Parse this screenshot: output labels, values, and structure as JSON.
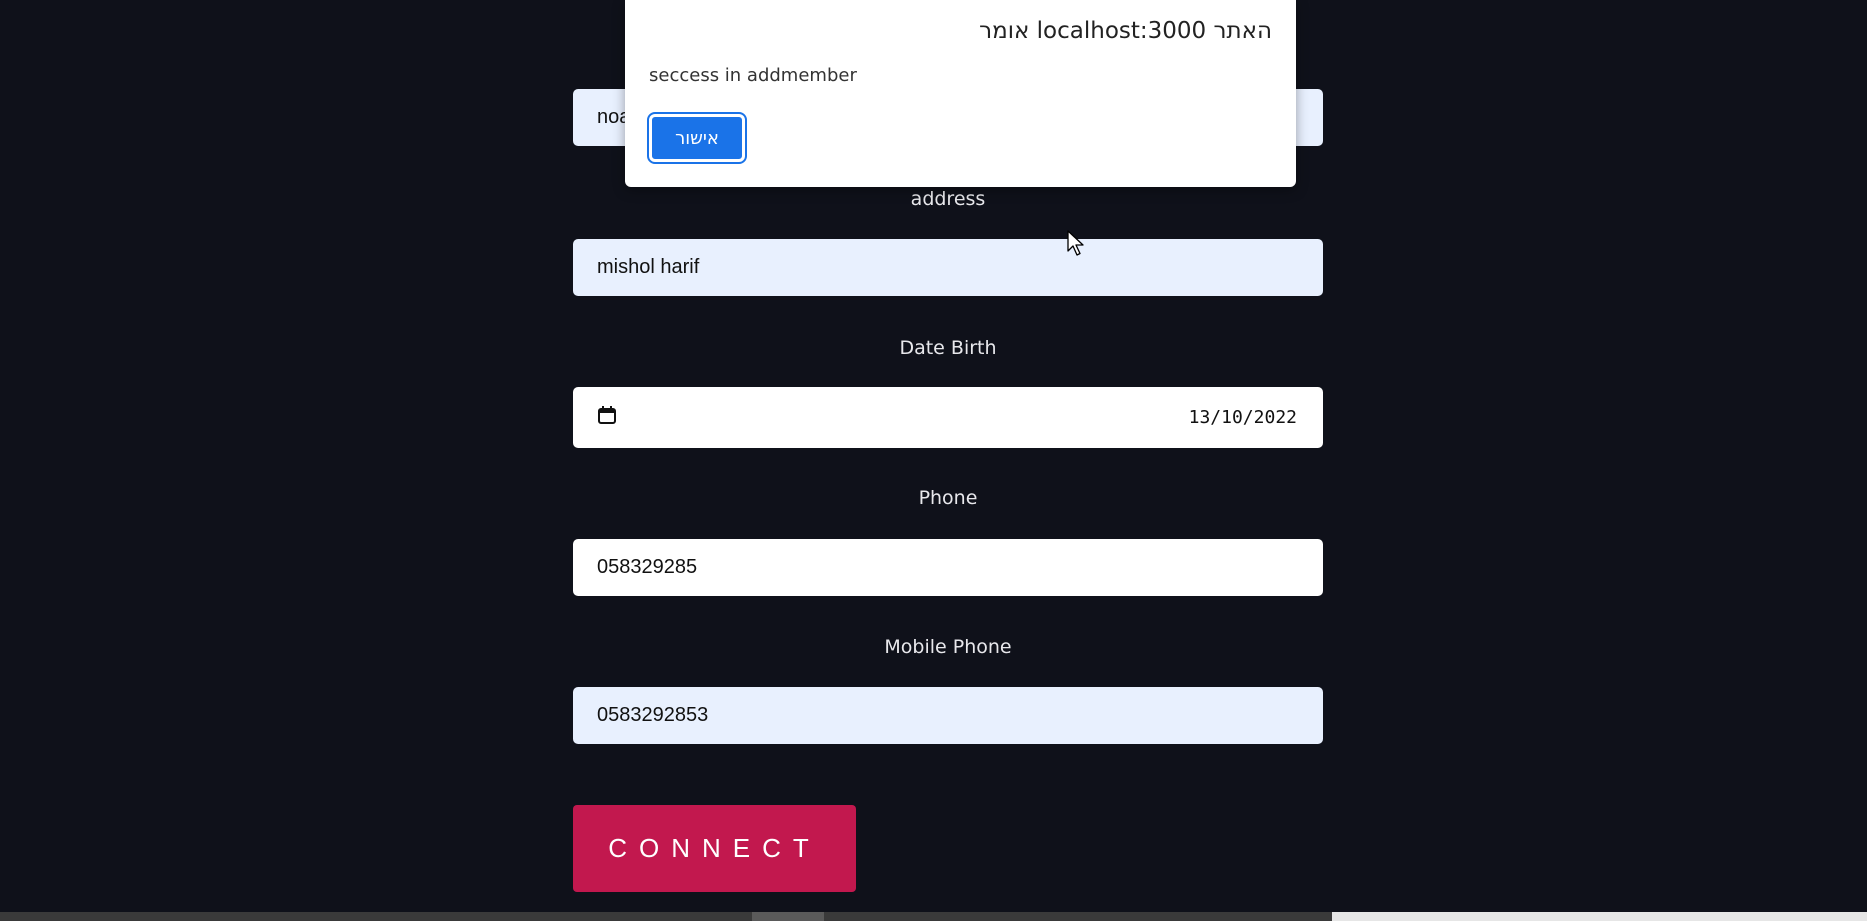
{
  "form": {
    "name_field_partial_value": "noa",
    "address_label": "address",
    "address_value": "mishol harif",
    "date_birth_label": "Date Birth",
    "date_birth_value": "13/10/2022",
    "phone_label": "Phone",
    "phone_value": "058329285",
    "mobile_phone_label": "Mobile Phone",
    "mobile_phone_value": "0583292853",
    "connect_label": "CONNECT"
  },
  "alert_dialog": {
    "title": "האתר localhost:3000 אומר",
    "message": "seccess in addmember",
    "ok_label": "אישור"
  },
  "icons": {
    "date_picker": "calendar-icon",
    "pointer": "mouse-cursor-icon"
  },
  "colors": {
    "page_background": "#0f111a",
    "autofill_background": "#e8f0fe",
    "connect_button": "#c2184e",
    "dialog_button": "#1a73e8"
  }
}
